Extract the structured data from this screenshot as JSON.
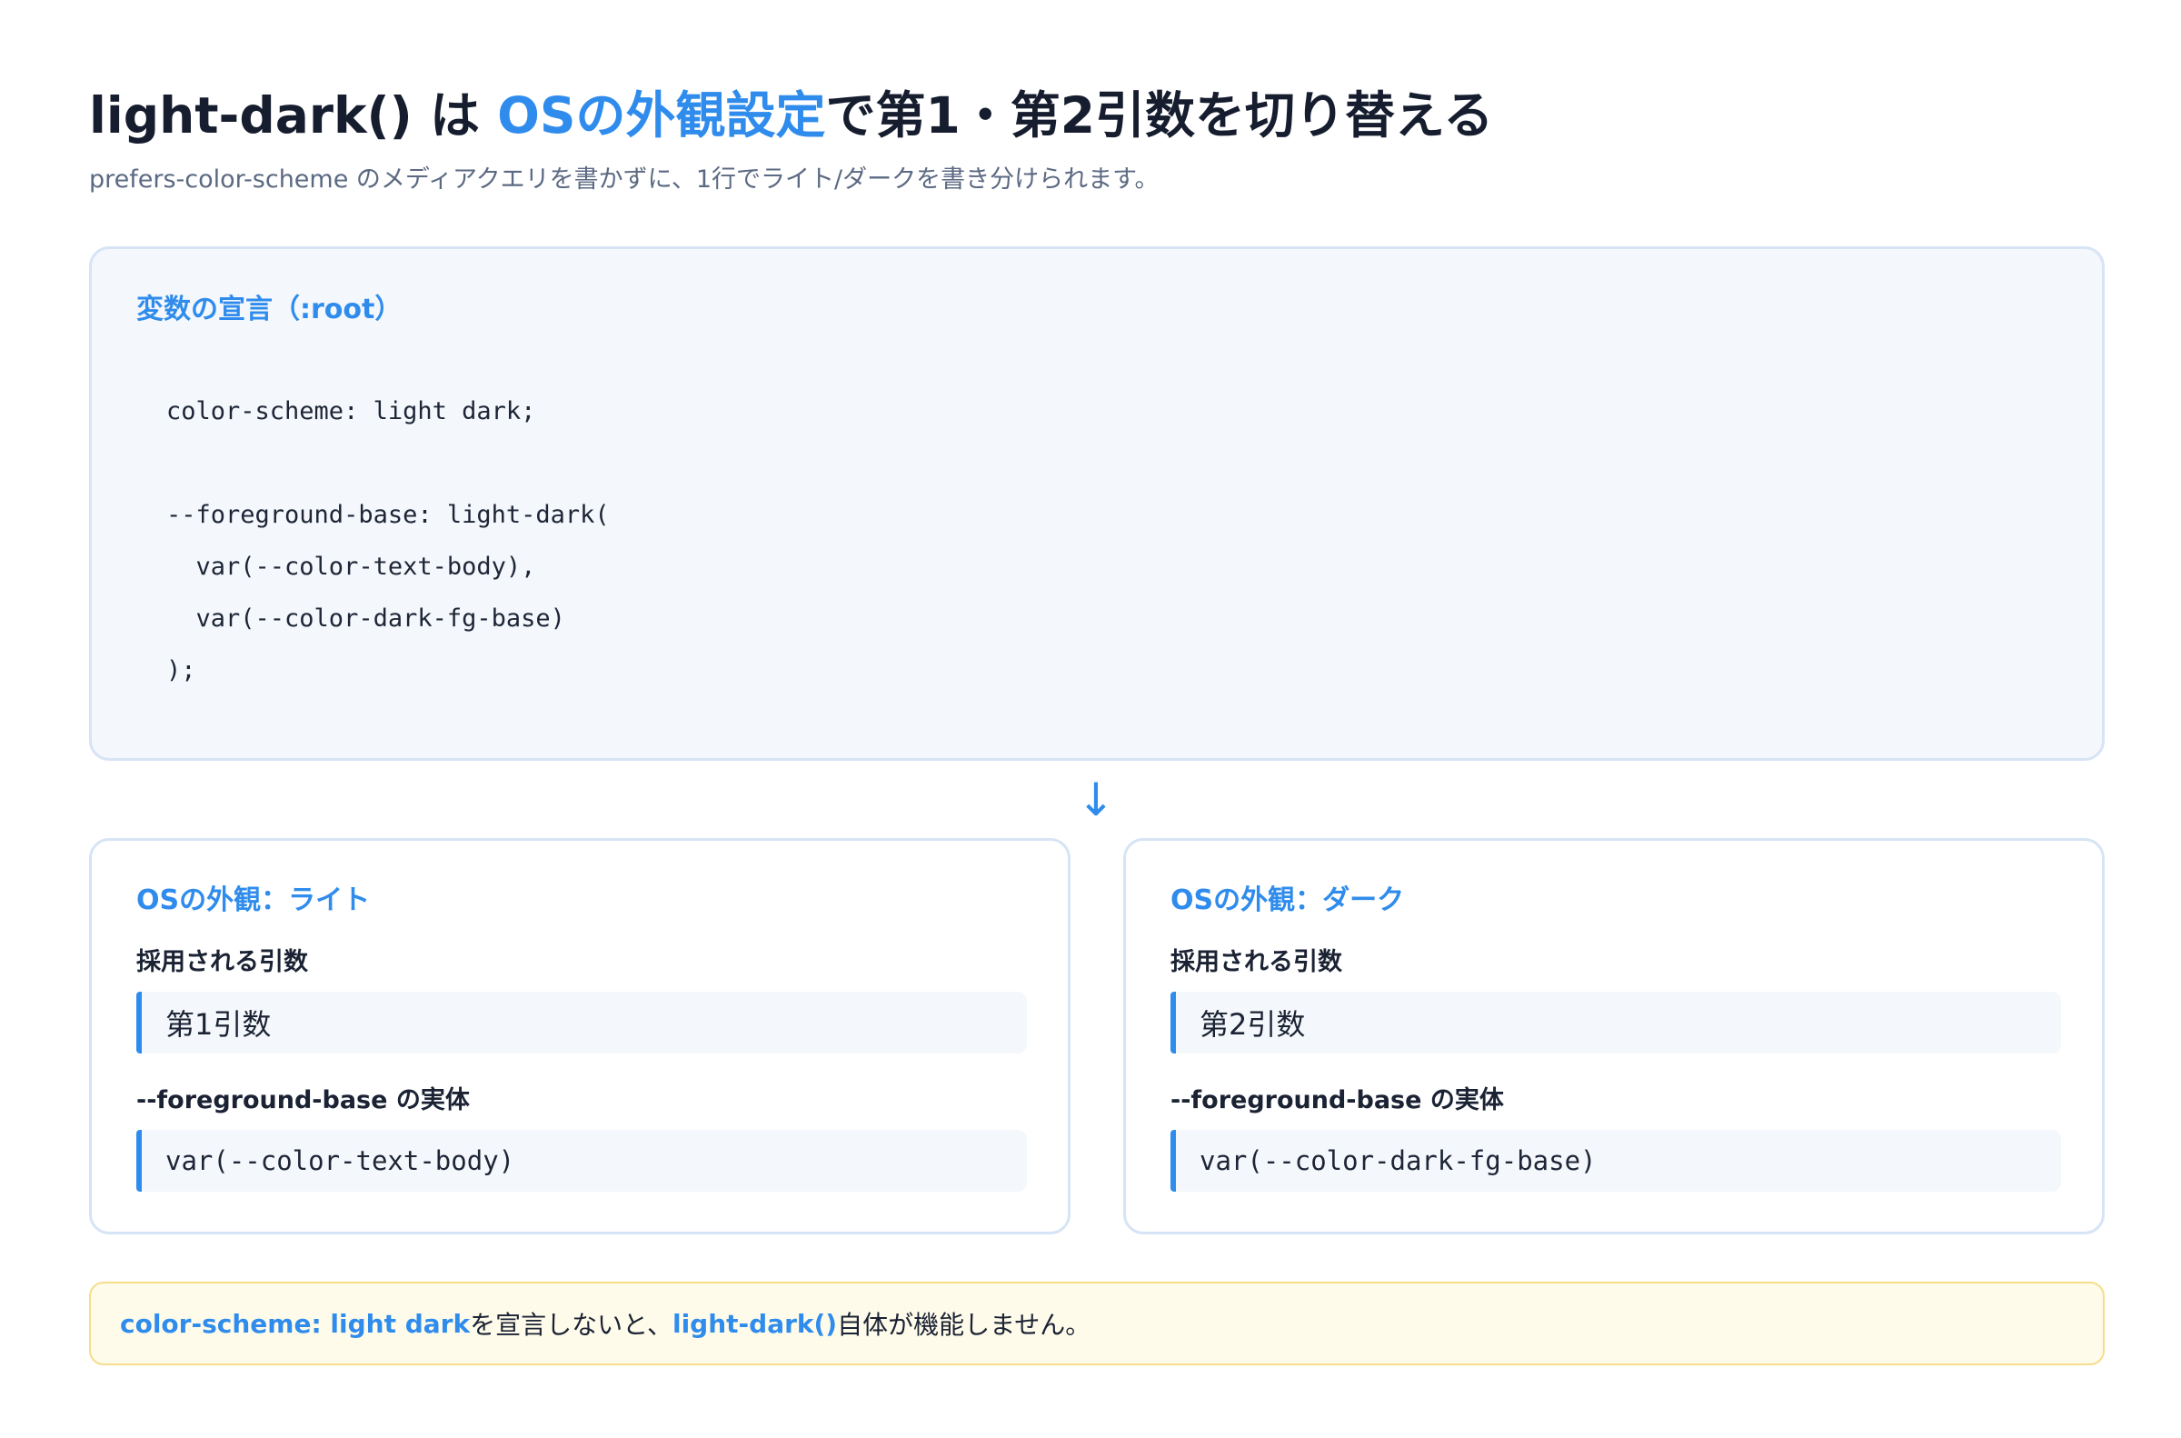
{
  "header": {
    "title_prefix": "light-dark() は ",
    "title_accent": "OSの外観設定",
    "title_suffix": "で第1・第2引数を切り替える",
    "subtitle": "prefers-color-scheme のメディアクエリを書かずに、1行でライト/ダークを書き分けられます。"
  },
  "code_card": {
    "heading": "変数の宣言（:root）",
    "lines": [
      "color-scheme: light dark;",
      "",
      "--foreground-base: light-dark(",
      "  var(--color-text-body),",
      "  var(--color-dark-fg-base)",
      ");"
    ]
  },
  "arrow": "↓",
  "light_card": {
    "heading": "OSの外観：ライト",
    "arg_label": "採用される引数",
    "arg_value": "第1引数",
    "entity_label": "--foreground-base の実体",
    "entity_value": "var(--color-text-body)"
  },
  "dark_card": {
    "heading": "OSの外観：ダーク",
    "arg_label": "採用される引数",
    "arg_value": "第2引数",
    "entity_label": "--foreground-base の実体",
    "entity_value": "var(--color-dark-fg-base)"
  },
  "note": {
    "kw1": "color-scheme: light dark",
    "text1": " を宣言しないと、",
    "kw2": "light-dark()",
    "text2": " 自体が機能しません。"
  },
  "colors": {
    "accent": "#2f8cec",
    "card_bg": "#f4f7fb",
    "card_border": "#d6e4f5",
    "note_bg": "#fffbea",
    "note_border": "#f5dd8a"
  }
}
